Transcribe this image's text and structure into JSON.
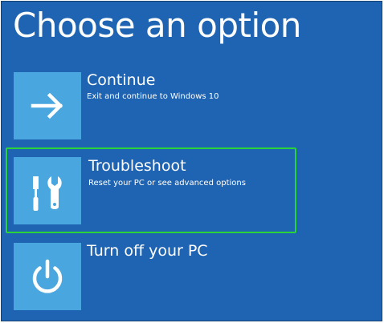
{
  "screen": {
    "title": "Choose an option",
    "background_color": "#1f64b3",
    "tile_color": "#4aa6df",
    "selection_color": "#2bd33b"
  },
  "options": [
    {
      "title": "Continue",
      "description": "Exit and continue to Windows 10",
      "icon": "arrow-right-icon"
    },
    {
      "title": "Troubleshoot",
      "description": "Reset your PC or see advanced options",
      "icon": "tools-icon",
      "selected": true
    },
    {
      "title": "Turn off your PC",
      "description": "",
      "icon": "power-icon"
    }
  ]
}
